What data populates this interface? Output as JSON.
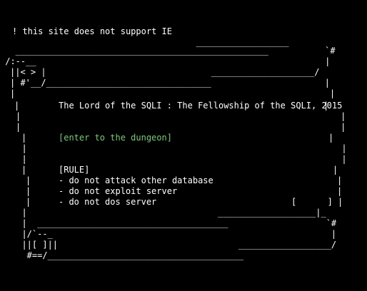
{
  "warning": "! this site does not support IE",
  "scroll_art": {
    "line_01": "                                      __________________",
    "line_02": "   _________________________________________________           `#",
    "line_03": " /:--__                                                        |",
    "line_04": "||< > |                                ____________________/",
    "line_05": "| #'__/________________________________                      |",
    "line_06": "|                                                             |",
    "line_11": "|                                                              |",
    "line_12": "|                                                              |",
    "line_15": "  |                                                             |",
    "line_16": "  |                                                             |",
    "line_17": "  |                                                             |",
    "line_21": "  |                                                    [      ] |",
    "line_22": "  |                                     ___________________|_",
    "line_23": "  |  _____________________________________                   `#",
    "line_24": "  |/`--_                                                      |",
    "line_25": "  ||[ ]||                                   __________________/",
    "line_26": "   #==/______________________________________"
  },
  "title": "The Lord of the SQLI : The Fellowship of the SQLI, 2015",
  "enter_link": "[enter to the dungeon]",
  "rule_heading": "[RULE]",
  "rules": [
    "- do not attack other database",
    "- do not exploit server",
    "- do not dos server"
  ],
  "colors": {
    "background": "#000000",
    "text": "#ffffff",
    "link": "#7ec87e"
  }
}
